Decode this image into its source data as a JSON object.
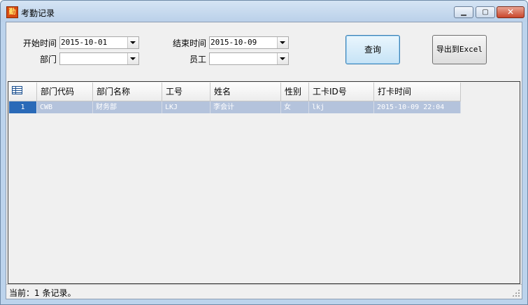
{
  "window": {
    "title": "考勤记录",
    "app_icon_glyph": "勤"
  },
  "filters": {
    "start_label": "开始时间",
    "start_value": "2015-10-01",
    "end_label": "结束时间",
    "end_value": "2015-10-09",
    "dept_label": "部门",
    "dept_value": "",
    "employee_label": "员工",
    "employee_value": ""
  },
  "buttons": {
    "query": "查询",
    "export": "导出到Excel"
  },
  "grid": {
    "columns": [
      "部门代码",
      "部门名称",
      "工号",
      "姓名",
      "性别",
      "工卡ID号",
      "打卡时间"
    ],
    "rows": [
      {
        "index": "1",
        "cells": [
          "CWB",
          "财务部",
          "LKJ",
          "李会计",
          "女",
          "lkj",
          "2015-10-09 22:04"
        ]
      }
    ]
  },
  "status": {
    "text": "当前：1 条记录。"
  },
  "colors": {
    "titlebar": "#bad0e9",
    "selected_row": "#b4c3dc",
    "row_indicator": "#2a6ab8",
    "close_button": "#c9462b"
  },
  "icons": [
    "app-icon",
    "minimize-icon",
    "maximize-icon",
    "close-icon",
    "dropdown-arrow-icon",
    "table-icon",
    "resize-grip-icon"
  ]
}
